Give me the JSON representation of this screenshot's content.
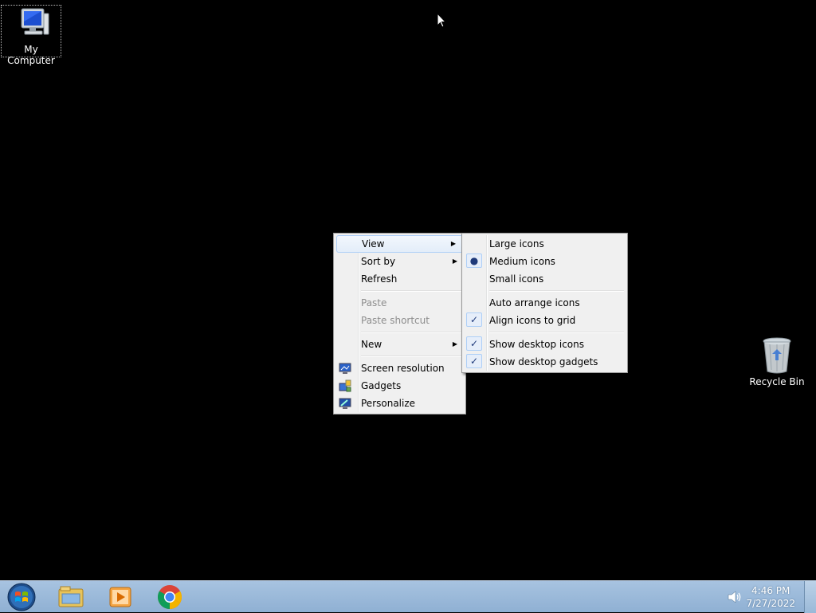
{
  "desktop": {
    "icons": [
      {
        "label": "My Computer"
      },
      {
        "label": "Recycle Bin"
      }
    ]
  },
  "context_menu": {
    "items": [
      {
        "label": "View",
        "submenu": true,
        "highlighted": true
      },
      {
        "label": "Sort by",
        "submenu": true
      },
      {
        "label": "Refresh"
      },
      {
        "label": "Paste",
        "disabled": true
      },
      {
        "label": "Paste shortcut",
        "disabled": true
      },
      {
        "label": "New",
        "submenu": true
      },
      {
        "label": "Screen resolution",
        "icon": "screen-resolution-icon"
      },
      {
        "label": "Gadgets",
        "icon": "gadgets-icon"
      },
      {
        "label": "Personalize",
        "icon": "personalize-icon"
      }
    ]
  },
  "view_submenu": {
    "items": [
      {
        "label": "Large icons",
        "state": "none"
      },
      {
        "label": "Medium icons",
        "state": "radio"
      },
      {
        "label": "Small icons",
        "state": "none"
      },
      {
        "label": "Auto arrange icons",
        "state": "none"
      },
      {
        "label": "Align icons to grid",
        "state": "checked"
      },
      {
        "label": "Show desktop icons",
        "state": "checked"
      },
      {
        "label": "Show desktop gadgets",
        "state": "checked"
      }
    ]
  },
  "taskbar": {
    "pinned": [
      "start-orb-icon",
      "windows-explorer-icon",
      "media-player-icon",
      "chrome-icon"
    ],
    "clock": {
      "time": "4:46 PM",
      "date": "7/27/2022"
    }
  },
  "colors": {
    "desktop_bg": "#000000",
    "menu_bg": "#f0f0f0",
    "taskbar": "#9ab8d8"
  }
}
